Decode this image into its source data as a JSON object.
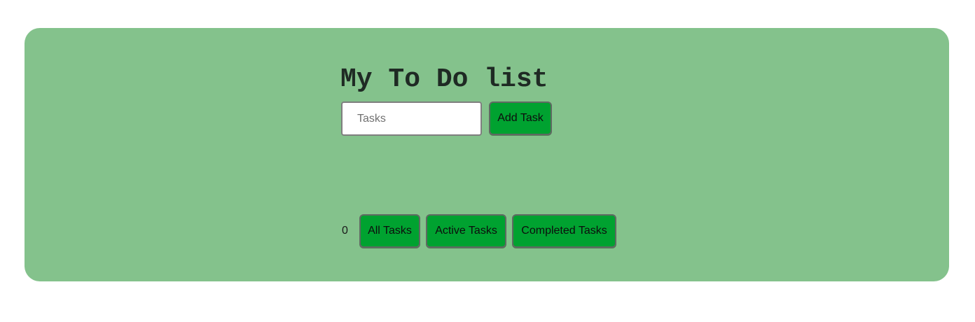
{
  "app": {
    "title": "My To Do list"
  },
  "form": {
    "input_value": "",
    "input_placeholder": "Tasks",
    "add_label": "Add Task"
  },
  "footer": {
    "task_count": "0",
    "filters": [
      {
        "label": "All Tasks"
      },
      {
        "label": "Active Tasks"
      },
      {
        "label": "Completed Tasks"
      }
    ]
  },
  "colors": {
    "card_background": "#84c28c",
    "button_background": "#00a230",
    "page_background": "#ffffff"
  }
}
